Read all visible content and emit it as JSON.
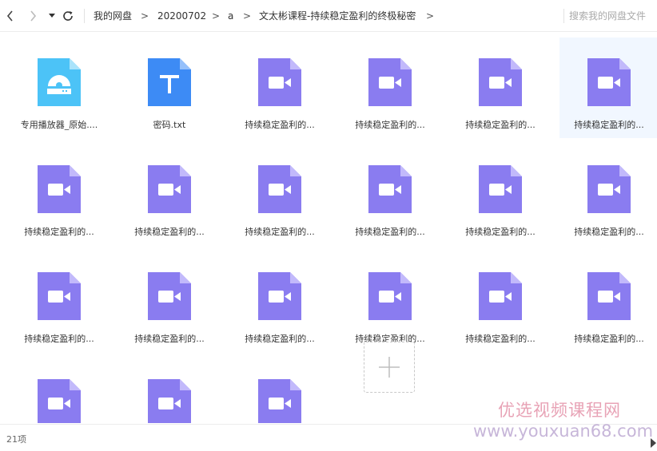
{
  "toolbar": {
    "breadcrumb": [
      "我的网盘",
      "20200702",
      "a",
      "文太彬课程-持续稳定盈利的终极秘密"
    ],
    "crumb_separator": ">",
    "search_placeholder": "搜索我的网盘文件"
  },
  "files": [
    {
      "name": "专用播放器_原始....",
      "type": "installer"
    },
    {
      "name": "密码.txt",
      "type": "text"
    },
    {
      "name": "持续稳定盈利的...",
      "type": "video"
    },
    {
      "name": "持续稳定盈利的...",
      "type": "video"
    },
    {
      "name": "持续稳定盈利的...",
      "type": "video"
    },
    {
      "name": "持续稳定盈利的...",
      "type": "video",
      "selected": true
    },
    {
      "name": "持续稳定盈利的...",
      "type": "video"
    },
    {
      "name": "持续稳定盈利的...",
      "type": "video"
    },
    {
      "name": "持续稳定盈利的...",
      "type": "video"
    },
    {
      "name": "持续稳定盈利的...",
      "type": "video"
    },
    {
      "name": "持续稳定盈利的...",
      "type": "video"
    },
    {
      "name": "持续稳定盈利的...",
      "type": "video"
    },
    {
      "name": "持续稳定盈利的...",
      "type": "video"
    },
    {
      "name": "持续稳定盈利的...",
      "type": "video"
    },
    {
      "name": "持续稳定盈利的...",
      "type": "video"
    },
    {
      "name": "持续稳定盈利的...",
      "type": "video"
    },
    {
      "name": "持续稳定盈利的...",
      "type": "video"
    },
    {
      "name": "持续稳定盈利的...",
      "type": "video"
    },
    {
      "name": "",
      "type": "video"
    },
    {
      "name": "",
      "type": "video"
    },
    {
      "name": "",
      "type": "video"
    }
  ],
  "status": {
    "item_count": "21项"
  },
  "watermark": {
    "line1": "优选视频课程网",
    "line2": "www.youxuan68.com"
  },
  "colors": {
    "video": "#8a7cf0",
    "text_file": "#3d8bf5",
    "installer": "#4cc3f7",
    "selected_bg": "#f1f7ff"
  }
}
